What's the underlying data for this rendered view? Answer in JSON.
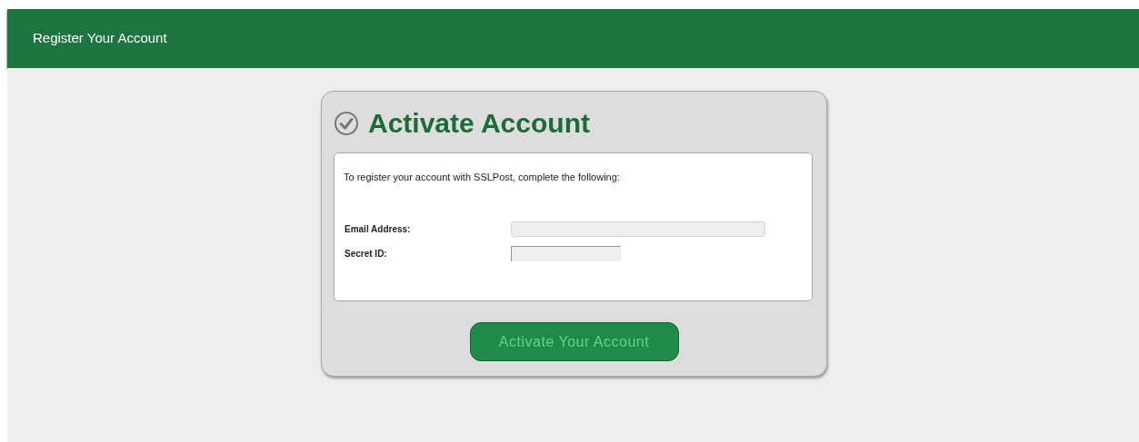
{
  "header": {
    "title": "Register Your Account"
  },
  "card": {
    "title": "Activate Account",
    "intro": "To register your account with SSLPost, complete the following:",
    "fields": [
      {
        "label": "Email Address:",
        "kind": "wide"
      },
      {
        "label": "Secret ID:",
        "kind": "short"
      }
    ],
    "button": "Activate Your Account"
  }
}
